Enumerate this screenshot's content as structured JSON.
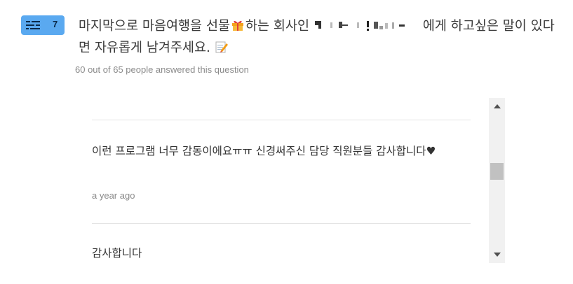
{
  "question": {
    "number": "7",
    "text_before_gift": "마지막으로 마음여행을 선물",
    "text_after_gift": "하는 회사인",
    "text_after_redaction": "에게 하고싶은 말이 있다면 자유롭게 남겨주세요.",
    "type_icon": "text-lines-icon",
    "gift_icon": "gift-emoji-icon",
    "memo_icon": "memo-pencil-emoji-icon"
  },
  "stats": {
    "answered": "60 out of 65 people answered this question"
  },
  "answers": [
    {
      "text": "이런 프로그램 너무 감동이에요ㅠㅠ 신경써주신 담당 직원분들 감사합니다♥",
      "time": "a year ago"
    },
    {
      "text": "감사합니다"
    }
  ],
  "colors": {
    "badge_bg": "#5aa9f0",
    "text": "#333333",
    "muted": "#8a8a8a",
    "divider": "#e4e4e4",
    "scroll_track": "#f1f1f1",
    "scroll_thumb": "#c1c1c1"
  }
}
